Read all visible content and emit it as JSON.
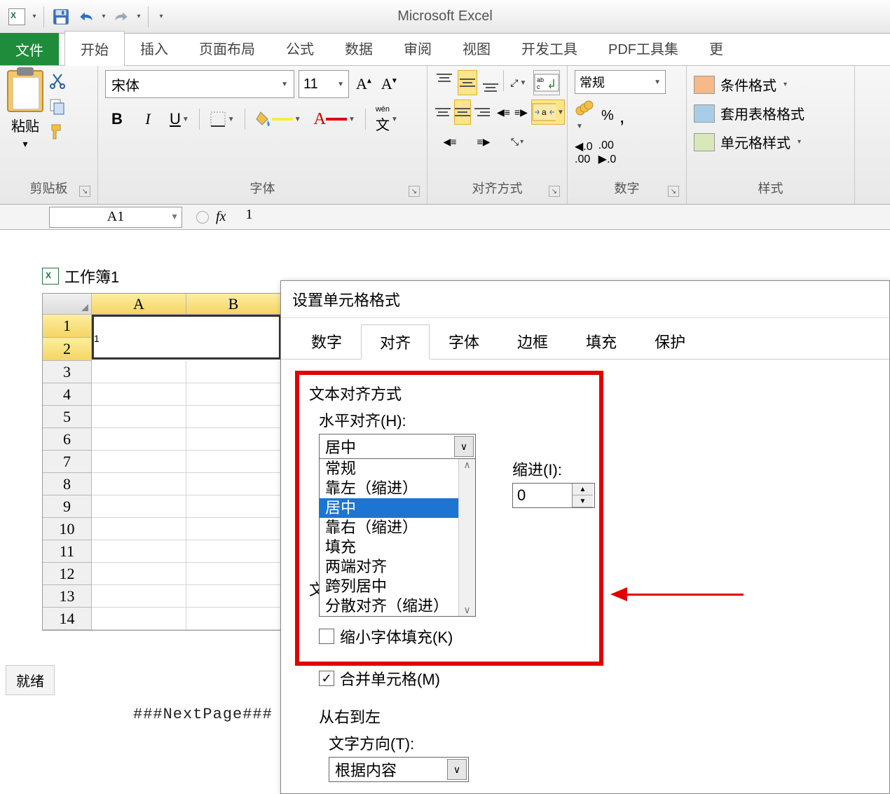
{
  "app_title": "Microsoft Excel",
  "qat": {
    "save": "保存",
    "undo": "撤销",
    "redo": "重做"
  },
  "tabs": {
    "file": "文件",
    "home": "开始",
    "insert": "插入",
    "page_layout": "页面布局",
    "formulas": "公式",
    "data": "数据",
    "review": "审阅",
    "view": "视图",
    "developer": "开发工具",
    "pdf": "PDF工具集",
    "more": "更"
  },
  "ribbon": {
    "clipboard": {
      "paste": "粘贴",
      "group_label": "剪贴板"
    },
    "font": {
      "name": "宋体",
      "size": "11",
      "bold": "B",
      "italic": "I",
      "underline": "U",
      "phonetic": "wén",
      "group_label": "字体"
    },
    "alignment": {
      "group_label": "对齐方式"
    },
    "number": {
      "format": "常规",
      "percent": "%",
      "comma": ",",
      "group_label": "数字"
    },
    "styles": {
      "conditional": "条件格式",
      "table": "套用表格格式",
      "cell": "单元格样式",
      "group_label": "样式"
    }
  },
  "formula_bar": {
    "name_box": "A1",
    "fx": "fx",
    "value": "1"
  },
  "workbook": {
    "title": "工作簿1",
    "columns": [
      "A",
      "B"
    ],
    "rows": [
      "1",
      "2",
      "3",
      "4",
      "5",
      "6",
      "7",
      "8",
      "9",
      "10",
      "11",
      "12",
      "13",
      "14"
    ],
    "a1_value": "1"
  },
  "dialog": {
    "title": "设置单元格格式",
    "tabs": {
      "number": "数字",
      "alignment": "对齐",
      "font": "字体",
      "border": "边框",
      "fill": "填充",
      "protection": "保护"
    },
    "text_align_section": "文本对齐方式",
    "horiz_label": "水平对齐(H):",
    "horiz_value": "居中",
    "horiz_options": [
      "常规",
      "靠左（缩进）",
      "居中",
      "靠右（缩进）",
      "填充",
      "两端对齐",
      "跨列居中",
      "分散对齐（缩进）"
    ],
    "indent_label": "缩进(I):",
    "indent_value": "0",
    "text_control_prefix": "文",
    "shrink_label": "缩小字体填充(K)",
    "merge_label": "合并单元格(M)",
    "rtl_section": "从右到左",
    "text_dir_label": "文字方向(T):",
    "text_dir_value": "根据内容"
  },
  "status": "就绪",
  "footer_artifact": "###NextPage###"
}
